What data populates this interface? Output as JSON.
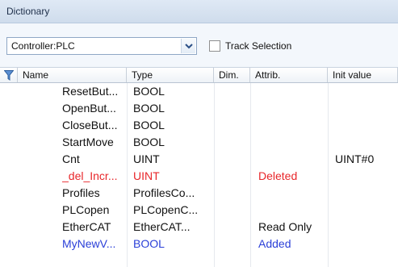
{
  "panel": {
    "title": "Dictionary"
  },
  "toolbar": {
    "controller_select": "Controller:PLC",
    "track_selection_label": "Track Selection",
    "track_selection_checked": false
  },
  "table": {
    "columns": [
      "Name",
      "Type",
      "Dim.",
      "Attrib.",
      "Init value"
    ],
    "filter_icon": "filter-funnel-icon",
    "rows": [
      {
        "name": "ResetBut...",
        "type": "BOOL",
        "dim": "",
        "attrib": "",
        "init": "",
        "color": "#111111"
      },
      {
        "name": "OpenBut...",
        "type": "BOOL",
        "dim": "",
        "attrib": "",
        "init": "",
        "color": "#111111"
      },
      {
        "name": "CloseBut...",
        "type": "BOOL",
        "dim": "",
        "attrib": "",
        "init": "",
        "color": "#111111"
      },
      {
        "name": "StartMove",
        "type": "BOOL",
        "dim": "",
        "attrib": "",
        "init": "",
        "color": "#111111"
      },
      {
        "name": "Cnt",
        "type": "UINT",
        "dim": "",
        "attrib": "",
        "init": "UINT#0",
        "color": "#111111"
      },
      {
        "name": "_del_Incr...",
        "type": "UINT",
        "dim": "",
        "attrib": "Deleted",
        "init": "",
        "color": "#e8262a"
      },
      {
        "name": "Profiles",
        "type": "ProfilesCo...",
        "dim": "",
        "attrib": "",
        "init": "",
        "color": "#111111"
      },
      {
        "name": "PLCopen",
        "type": "PLCopenC...",
        "dim": "",
        "attrib": "",
        "init": "",
        "color": "#111111"
      },
      {
        "name": "EtherCAT",
        "type": "EtherCAT...",
        "dim": "",
        "attrib": "Read Only",
        "init": "",
        "color": "#111111"
      },
      {
        "name": "MyNewV...",
        "type": "BOOL",
        "dim": "",
        "attrib": "Added",
        "init": "",
        "color": "#2a3fd8"
      }
    ]
  }
}
